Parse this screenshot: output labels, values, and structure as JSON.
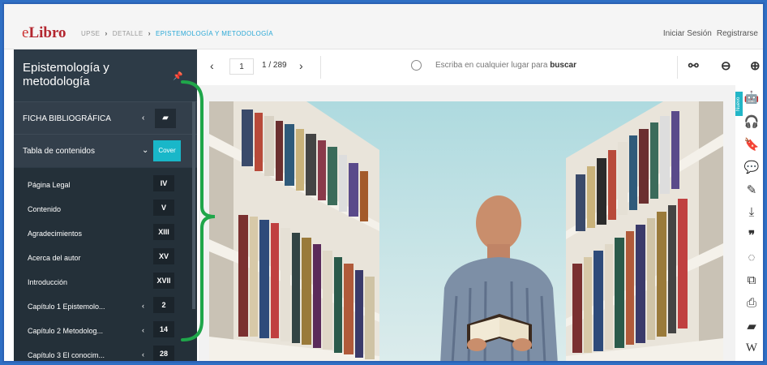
{
  "header": {
    "logo_e": "e",
    "logo_libro": "Libro",
    "breadcrumbs": [
      "UPSE",
      "DETALLE",
      "EPISTEMOLOGÍA Y METODOLOGÍA"
    ],
    "login": "Iniciar Sesión",
    "register": "Registrarse"
  },
  "sidebar": {
    "title": "Epistemología y metodología",
    "ficha_label": "FICHA BIBLIOGRÁFICA",
    "toc_label": "Tabla de contenidos",
    "cover_label": "Cover",
    "toc": [
      {
        "label": "Página Legal",
        "page": "IV",
        "chevron": false
      },
      {
        "label": "Contenido",
        "page": "V",
        "chevron": false
      },
      {
        "label": "Agradecimientos",
        "page": "XIII",
        "chevron": false
      },
      {
        "label": "Acerca del autor",
        "page": "XV",
        "chevron": false
      },
      {
        "label": "Introducción",
        "page": "XVII",
        "chevron": false
      },
      {
        "label": "Capítulo 1 Epistemolo...",
        "page": "2",
        "chevron": true
      },
      {
        "label": "Capítulo 2 Metodolog...",
        "page": "14",
        "chevron": true
      },
      {
        "label": "Capítulo 3 El conocim...",
        "page": "28",
        "chevron": true
      }
    ]
  },
  "toolbar": {
    "current_page": "1",
    "total": "1 / 289",
    "search_placeholder": "Escriba en cualquier lugar para",
    "search_bold": "buscar"
  },
  "rail": {
    "nuevo_label": "Nuevo"
  },
  "colors": {
    "sidebar_bg": "#2d3b47",
    "accent": "#19b7c9",
    "annotation": "#1fa64a",
    "frame": "#2f6fc4"
  }
}
